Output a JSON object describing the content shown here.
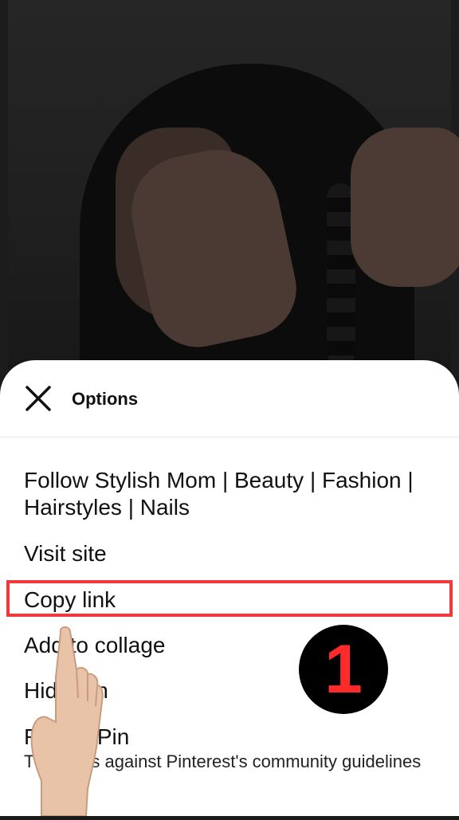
{
  "sheet": {
    "title": "Options"
  },
  "menu": {
    "follow": "Follow Stylish Mom | Beauty | Fashion | Hairstyles | Nails",
    "visit_site": "Visit site",
    "copy_link": "Copy link",
    "add_to_collage": "Add to collage",
    "hide_pin": "Hide Pin",
    "report_pin": "Report Pin",
    "report_desc": "This goes against Pinterest's community guidelines"
  },
  "annotation": {
    "step_number": "1",
    "highlight_color": "#f0393a",
    "badge_text_color": "#ff2b2b"
  }
}
